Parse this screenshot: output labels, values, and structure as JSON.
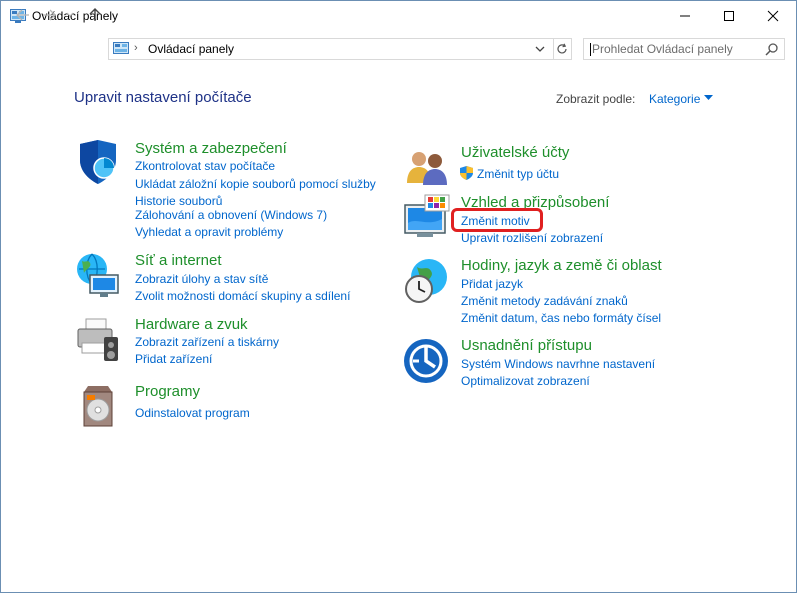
{
  "window": {
    "title": "Ovládací panely",
    "controls": {
      "minimize": "minimize-icon",
      "maximize": "maximize-icon",
      "close": "close-icon"
    }
  },
  "nav": {
    "breadcrumb_separator": "›",
    "breadcrumb": "Ovládací panely",
    "search_placeholder": "Prohledat Ovládací panely"
  },
  "header": {
    "title": "Upravit nastavení počítače",
    "view_by_label": "Zobrazit podle:",
    "view_by_value": "Kategorie"
  },
  "categories_left": [
    {
      "title": "Systém a zabezpečení",
      "icon": "shield-icon",
      "links": [
        "Zkontrolovat stav počítače",
        "Ukládat záložní kopie souborů pomocí služby Historie souborů",
        "Zálohování a obnovení (Windows 7)",
        "Vyhledat a opravit problémy"
      ]
    },
    {
      "title": "Síť a internet",
      "icon": "network-globe-icon",
      "links": [
        "Zobrazit úlohy a stav sítě",
        "Zvolit možnosti domácí skupiny a sdílení"
      ]
    },
    {
      "title": "Hardware a zvuk",
      "icon": "printer-speaker-icon",
      "links": [
        "Zobrazit zařízení a tiskárny",
        "Přidat zařízení"
      ]
    },
    {
      "title": "Programy",
      "icon": "programs-disc-icon",
      "links": [
        "Odinstalovat program"
      ]
    }
  ],
  "categories_right": [
    {
      "title": "Uživatelské účty",
      "icon": "users-icon",
      "links": [
        "Změnit typ účtu"
      ]
    },
    {
      "title": "Vzhled a přizpůsobení",
      "icon": "monitor-palette-icon",
      "links": [
        "Změnit motiv",
        "Upravit rozlišení zobrazení"
      ]
    },
    {
      "title": "Hodiny, jazyk a země či oblast",
      "icon": "clock-globe-icon",
      "links": [
        "Přidat jazyk",
        "Změnit metody zadávání znaků",
        "Změnit datum, čas nebo formáty čísel"
      ]
    },
    {
      "title": "Usnadnění přístupu",
      "icon": "accessibility-icon",
      "links": [
        "Systém Windows navrhne nastavení",
        "Optimalizovat zobrazení"
      ]
    }
  ],
  "colors": {
    "heading": "#1e3287",
    "category_title": "#1e8f2b",
    "link": "#0066cc",
    "highlight": "#e02020"
  }
}
